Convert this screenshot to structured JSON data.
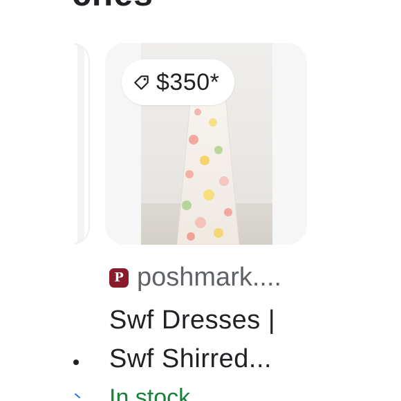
{
  "section": {
    "title": "ches"
  },
  "product": {
    "price": "$350*",
    "price_icon": "tag-icon",
    "source_icon": "poshmark-logo-icon",
    "source": "poshmark....",
    "title_line1": "Swf Dresses |",
    "title_line2": "Swf Shirred...",
    "stock": "In stock"
  },
  "colors": {
    "price_text": "#202124",
    "source_text": "#5f6368",
    "stock_text": "#188038",
    "brand_logo": "#8a1c2b"
  }
}
